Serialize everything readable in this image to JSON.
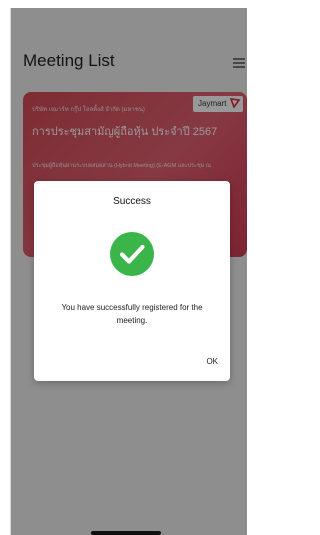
{
  "header": {
    "title": "Meeting List",
    "menu_icon": "hamburger-menu-icon"
  },
  "meeting_card": {
    "company": "บริษัท เจมาร์ท กรุ๊ป โฮลดิ้งส์ จำกัด (มหาชน)",
    "logo_text": "Jaymart",
    "title": "การประชุมสามัญผู้ถือหุ้น ประจำปี 2567",
    "description": "ประชุมผู้ถือหุ้นผ่านระบบผสมผสาน (Hybrid Meeting) (E-AGM และประชุม ณ",
    "colors": {
      "gradient_start": "#d14a55",
      "gradient_end": "#d23b52"
    }
  },
  "dialog": {
    "title": "Success",
    "icon": "success-check-icon",
    "icon_color": "#3bb54a",
    "message": "You have successfully registered for the meeting.",
    "ok_label": "OK"
  }
}
